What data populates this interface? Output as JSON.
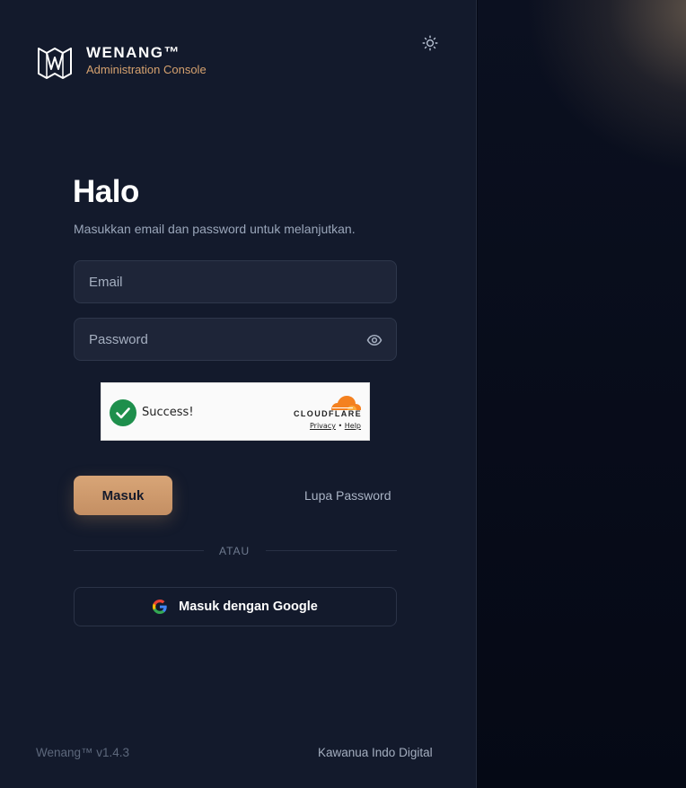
{
  "brand": {
    "name": "WENANG™",
    "subtitle": "Administration Console"
  },
  "heading": {
    "title": "Halo",
    "subtitle": "Masukkan email dan password untuk melanjutkan."
  },
  "form": {
    "email_placeholder": "Email",
    "email_value": "",
    "password_placeholder": "Password",
    "password_value": ""
  },
  "captcha": {
    "status": "Success!",
    "provider": "CLOUDFLARE",
    "privacy_label": "Privacy",
    "separator": "•",
    "help_label": "Help"
  },
  "actions": {
    "login_label": "Masuk",
    "forgot_label": "Lupa Password",
    "divider_label": "ATAU",
    "google_label": "Masuk dengan Google"
  },
  "footer": {
    "version": "Wenang™ v1.4.3",
    "company": "Kawanua Indo Digital"
  },
  "colors": {
    "accent": "#d6a26f",
    "panel": "#131a2c",
    "background": "#050915",
    "captcha_success": "#1e8f4c",
    "cloudflare_orange": "#f48120"
  },
  "icons": {
    "logo": "wenang-logo-icon",
    "theme": "sun-icon",
    "password_toggle": "eye-icon",
    "captcha": "check-circle-icon",
    "cloudflare": "cloudflare-cloud-icon",
    "google": "google-icon"
  }
}
